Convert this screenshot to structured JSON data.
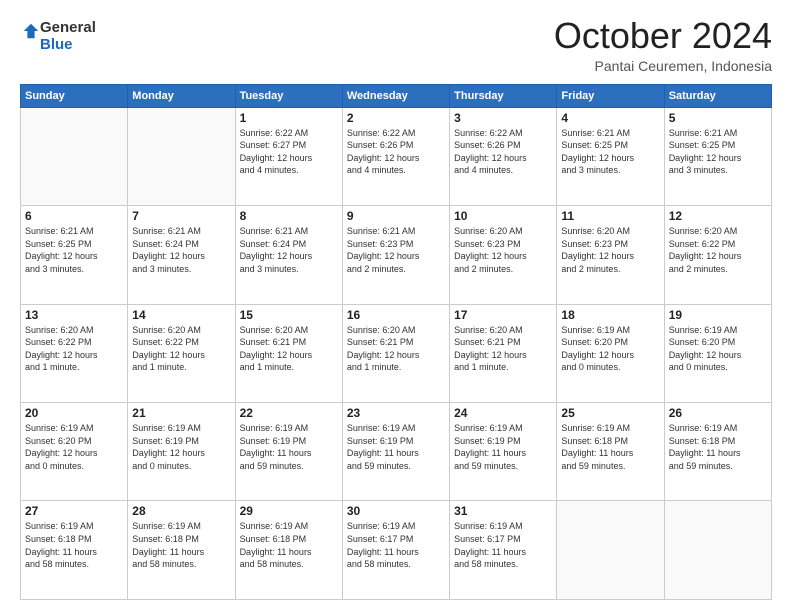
{
  "logo": {
    "general": "General",
    "blue": "Blue"
  },
  "header": {
    "month": "October 2024",
    "location": "Pantai Ceuremen, Indonesia"
  },
  "weekdays": [
    "Sunday",
    "Monday",
    "Tuesday",
    "Wednesday",
    "Thursday",
    "Friday",
    "Saturday"
  ],
  "weeks": [
    [
      {
        "day": "",
        "info": ""
      },
      {
        "day": "",
        "info": ""
      },
      {
        "day": "1",
        "info": "Sunrise: 6:22 AM\nSunset: 6:27 PM\nDaylight: 12 hours\nand 4 minutes."
      },
      {
        "day": "2",
        "info": "Sunrise: 6:22 AM\nSunset: 6:26 PM\nDaylight: 12 hours\nand 4 minutes."
      },
      {
        "day": "3",
        "info": "Sunrise: 6:22 AM\nSunset: 6:26 PM\nDaylight: 12 hours\nand 4 minutes."
      },
      {
        "day": "4",
        "info": "Sunrise: 6:21 AM\nSunset: 6:25 PM\nDaylight: 12 hours\nand 3 minutes."
      },
      {
        "day": "5",
        "info": "Sunrise: 6:21 AM\nSunset: 6:25 PM\nDaylight: 12 hours\nand 3 minutes."
      }
    ],
    [
      {
        "day": "6",
        "info": "Sunrise: 6:21 AM\nSunset: 6:25 PM\nDaylight: 12 hours\nand 3 minutes."
      },
      {
        "day": "7",
        "info": "Sunrise: 6:21 AM\nSunset: 6:24 PM\nDaylight: 12 hours\nand 3 minutes."
      },
      {
        "day": "8",
        "info": "Sunrise: 6:21 AM\nSunset: 6:24 PM\nDaylight: 12 hours\nand 3 minutes."
      },
      {
        "day": "9",
        "info": "Sunrise: 6:21 AM\nSunset: 6:23 PM\nDaylight: 12 hours\nand 2 minutes."
      },
      {
        "day": "10",
        "info": "Sunrise: 6:20 AM\nSunset: 6:23 PM\nDaylight: 12 hours\nand 2 minutes."
      },
      {
        "day": "11",
        "info": "Sunrise: 6:20 AM\nSunset: 6:23 PM\nDaylight: 12 hours\nand 2 minutes."
      },
      {
        "day": "12",
        "info": "Sunrise: 6:20 AM\nSunset: 6:22 PM\nDaylight: 12 hours\nand 2 minutes."
      }
    ],
    [
      {
        "day": "13",
        "info": "Sunrise: 6:20 AM\nSunset: 6:22 PM\nDaylight: 12 hours\nand 1 minute."
      },
      {
        "day": "14",
        "info": "Sunrise: 6:20 AM\nSunset: 6:22 PM\nDaylight: 12 hours\nand 1 minute."
      },
      {
        "day": "15",
        "info": "Sunrise: 6:20 AM\nSunset: 6:21 PM\nDaylight: 12 hours\nand 1 minute."
      },
      {
        "day": "16",
        "info": "Sunrise: 6:20 AM\nSunset: 6:21 PM\nDaylight: 12 hours\nand 1 minute."
      },
      {
        "day": "17",
        "info": "Sunrise: 6:20 AM\nSunset: 6:21 PM\nDaylight: 12 hours\nand 1 minute."
      },
      {
        "day": "18",
        "info": "Sunrise: 6:19 AM\nSunset: 6:20 PM\nDaylight: 12 hours\nand 0 minutes."
      },
      {
        "day": "19",
        "info": "Sunrise: 6:19 AM\nSunset: 6:20 PM\nDaylight: 12 hours\nand 0 minutes."
      }
    ],
    [
      {
        "day": "20",
        "info": "Sunrise: 6:19 AM\nSunset: 6:20 PM\nDaylight: 12 hours\nand 0 minutes."
      },
      {
        "day": "21",
        "info": "Sunrise: 6:19 AM\nSunset: 6:19 PM\nDaylight: 12 hours\nand 0 minutes."
      },
      {
        "day": "22",
        "info": "Sunrise: 6:19 AM\nSunset: 6:19 PM\nDaylight: 11 hours\nand 59 minutes."
      },
      {
        "day": "23",
        "info": "Sunrise: 6:19 AM\nSunset: 6:19 PM\nDaylight: 11 hours\nand 59 minutes."
      },
      {
        "day": "24",
        "info": "Sunrise: 6:19 AM\nSunset: 6:19 PM\nDaylight: 11 hours\nand 59 minutes."
      },
      {
        "day": "25",
        "info": "Sunrise: 6:19 AM\nSunset: 6:18 PM\nDaylight: 11 hours\nand 59 minutes."
      },
      {
        "day": "26",
        "info": "Sunrise: 6:19 AM\nSunset: 6:18 PM\nDaylight: 11 hours\nand 59 minutes."
      }
    ],
    [
      {
        "day": "27",
        "info": "Sunrise: 6:19 AM\nSunset: 6:18 PM\nDaylight: 11 hours\nand 58 minutes."
      },
      {
        "day": "28",
        "info": "Sunrise: 6:19 AM\nSunset: 6:18 PM\nDaylight: 11 hours\nand 58 minutes."
      },
      {
        "day": "29",
        "info": "Sunrise: 6:19 AM\nSunset: 6:18 PM\nDaylight: 11 hours\nand 58 minutes."
      },
      {
        "day": "30",
        "info": "Sunrise: 6:19 AM\nSunset: 6:17 PM\nDaylight: 11 hours\nand 58 minutes."
      },
      {
        "day": "31",
        "info": "Sunrise: 6:19 AM\nSunset: 6:17 PM\nDaylight: 11 hours\nand 58 minutes."
      },
      {
        "day": "",
        "info": ""
      },
      {
        "day": "",
        "info": ""
      }
    ]
  ]
}
